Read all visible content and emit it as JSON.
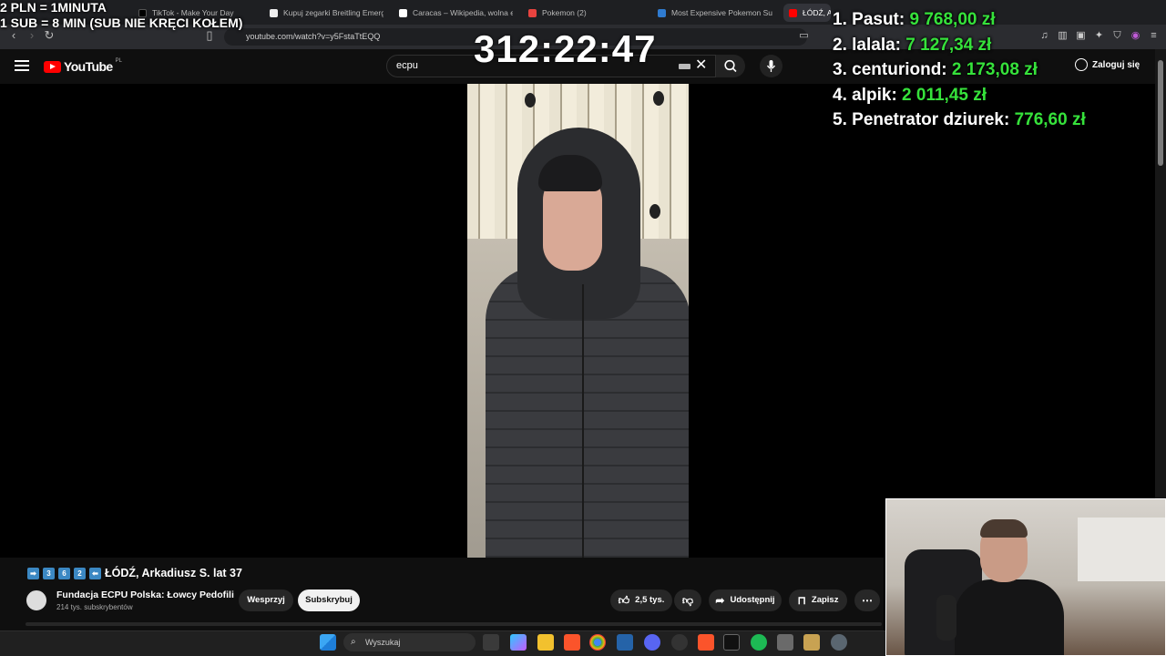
{
  "overlay": {
    "line1": "2 PLN = 1MINUTA",
    "line2": "1 SUB = 8 MIN (SUB NIE KRĘCI KOŁEM)",
    "timer": "312:22:47"
  },
  "leaderboard": [
    {
      "rank": "1.",
      "name": "Pasut:",
      "amount": "9 768,00 zł"
    },
    {
      "rank": "2.",
      "name": "lalala:",
      "amount": "7 127,34 zł"
    },
    {
      "rank": "3.",
      "name": "centuriond:",
      "amount": "2 173,08 zł"
    },
    {
      "rank": "4.",
      "name": "alpik:",
      "amount": "2 011,45 zł"
    },
    {
      "rank": "5.",
      "name": "Penetrator dziurek:",
      "amount": "776,60 zł"
    }
  ],
  "browser": {
    "tabs": [
      {
        "title": "TikTok - Make Your Day",
        "color": "#000000"
      },
      {
        "title": "Kupuj zegarki Breitling Emerge",
        "color": "#ffffff"
      },
      {
        "title": "Caracas – Wikipedia, wolna en",
        "color": "#ffffff"
      },
      {
        "title": "Pokemon (2)",
        "color": "#e8433f"
      },
      {
        "title": "Most Expensive Pokemon Surg",
        "color": "#2f7bd0"
      },
      {
        "title": "ŁÓDŹ, Ar",
        "color": "#ff0000"
      }
    ],
    "url": "youtube.com/watch?v=y5FstaTtEQQ"
  },
  "youtube": {
    "logo_text": "YouTube",
    "region": "PL",
    "search_value": "ecpu",
    "login_label": "Zaloguj się"
  },
  "video": {
    "keycaps": [
      "➡",
      "3",
      "6",
      "2",
      "⬅"
    ],
    "title": "ŁÓDŹ, Arkadiusz S. lat 37",
    "channel_name": "Fundacja ECPU Polska: Łowcy Pedofili",
    "subscribers": "214 tys. subskrybentów",
    "support_label": "Wesprzyj",
    "subscribe_label": "Subskrybuj",
    "likes": "2,5 tys.",
    "share_label": "Udostępnij",
    "save_label": "Zapisz"
  },
  "taskbar": {
    "search_placeholder": "Wyszukaj"
  },
  "colors": {
    "accent_green": "#36e23b",
    "youtube_red": "#ff0000"
  }
}
